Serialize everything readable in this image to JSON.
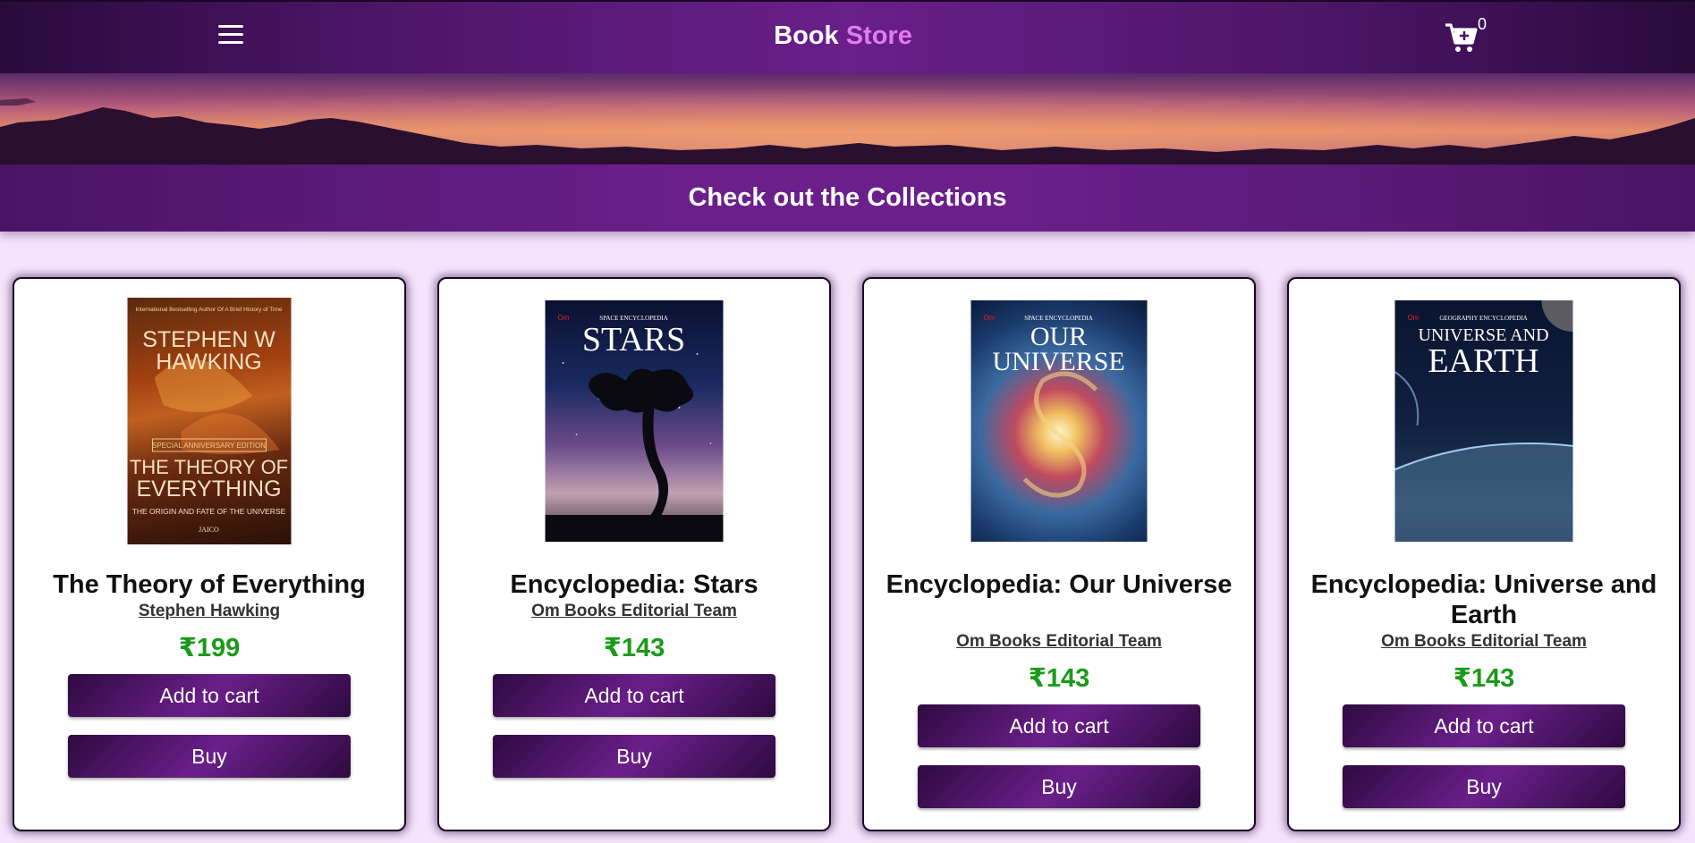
{
  "header": {
    "brand_main": "Book",
    "brand_accent": "Store",
    "cart_count": "0",
    "colors": {
      "bar": "#4a1464",
      "accent": "#e07cf0"
    }
  },
  "collections": {
    "heading": "Check out the Collections"
  },
  "books": [
    {
      "title": "The Theory of Everything",
      "author": "Stephen Hawking",
      "price": "₹199",
      "add_label": "Add to cart",
      "buy_label": "Buy",
      "cover": {
        "top_line": "International Bestselling Author Of A Brief History of Time",
        "author_line": "STEPHEN W HAWKING",
        "edition": "SPECIAL ANNIVERSARY EDITION",
        "title_line": "THE THEORY OF EVERYTHING",
        "subtitle": "THE ORIGIN AND FATE OF THE UNIVERSE",
        "publisher": "JAICO"
      }
    },
    {
      "title": "Encyclopedia: Stars",
      "author": "Om Books Editorial Team",
      "price": "₹143",
      "add_label": "Add to cart",
      "buy_label": "Buy",
      "cover": {
        "publisher": "Om",
        "series": "SPACE ENCYCLOPEDIA",
        "title_line": "STARS"
      }
    },
    {
      "title": "Encyclopedia: Our Universe",
      "author": "Om Books Editorial Team",
      "price": "₹143",
      "add_label": "Add to cart",
      "buy_label": "Buy",
      "cover": {
        "publisher": "Om",
        "series": "SPACE ENCYCLOPEDIA",
        "title_line": "OUR UNIVERSE"
      }
    },
    {
      "title": "Encyclopedia: Universe and Earth",
      "author": "Om Books Editorial Team",
      "price": "₹143",
      "add_label": "Add to cart",
      "buy_label": "Buy",
      "cover": {
        "publisher": "Om",
        "series": "GEOGRAPHY ENCYCLOPEDIA",
        "title_line": "UNIVERSE AND EARTH"
      }
    }
  ]
}
